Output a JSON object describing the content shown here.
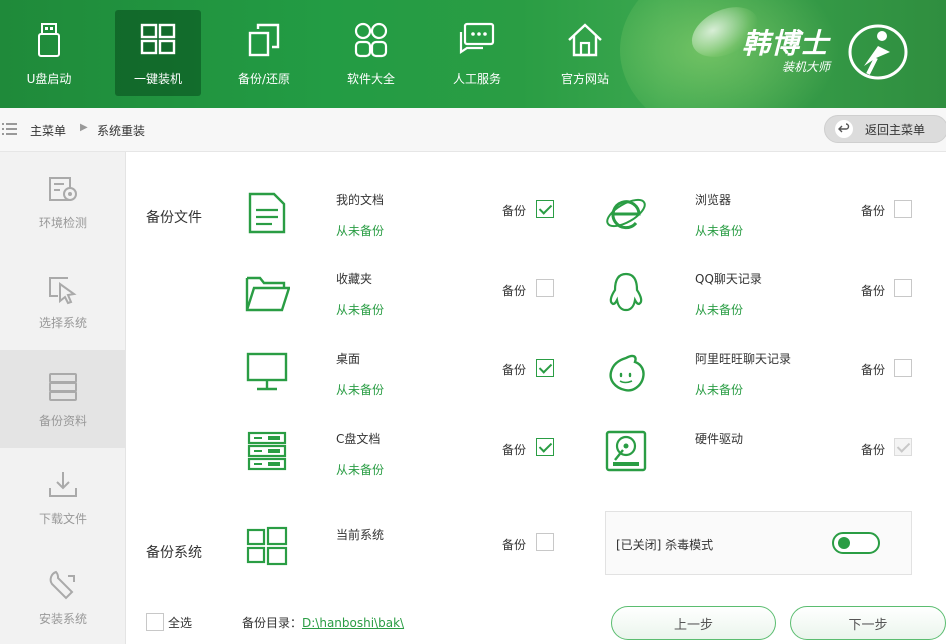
{
  "header": {
    "nav": [
      {
        "label": "U盘启动",
        "icon": "usb-drive-icon"
      },
      {
        "label": "一键装机",
        "icon": "windows-icon"
      },
      {
        "label": "备份/还原",
        "icon": "backup-restore-icon"
      },
      {
        "label": "软件大全",
        "icon": "apps-grid-icon"
      },
      {
        "label": "人工服务",
        "icon": "chat-icon"
      },
      {
        "label": "官方网站",
        "icon": "home-icon"
      }
    ],
    "active_index": 1,
    "brand_title": "韩博士",
    "brand_subtitle": "装机大师"
  },
  "breadcrumb": {
    "root": "主菜单",
    "current": "系统重装",
    "back_label": "返回主菜单"
  },
  "sidebar": {
    "items": [
      {
        "label": "环境检测",
        "icon": "environment-check-icon"
      },
      {
        "label": "选择系统",
        "icon": "cursor-select-icon"
      },
      {
        "label": "备份资料",
        "icon": "backup-data-icon"
      },
      {
        "label": "下载文件",
        "icon": "download-icon"
      },
      {
        "label": "安装系统",
        "icon": "wrench-install-icon"
      }
    ],
    "active_index": 2
  },
  "backup_files": {
    "title": "备份文件",
    "backup_label": "备份",
    "left": [
      {
        "name": "我的文档",
        "status": "从未备份",
        "checked": true,
        "icon": "document-icon"
      },
      {
        "name": "收藏夹",
        "status": "从未备份",
        "checked": false,
        "icon": "folder-icon"
      },
      {
        "name": "桌面",
        "status": "从未备份",
        "checked": true,
        "icon": "monitor-icon"
      },
      {
        "name": "C盘文档",
        "status": "从未备份",
        "checked": true,
        "icon": "server-rack-icon"
      }
    ],
    "right": [
      {
        "name": "浏览器",
        "status": "从未备份",
        "checked": false,
        "icon": "ie-browser-icon"
      },
      {
        "name": "QQ聊天记录",
        "status": "从未备份",
        "checked": false,
        "icon": "qq-penguin-icon"
      },
      {
        "name": "阿里旺旺聊天记录",
        "status": "从未备份",
        "checked": false,
        "icon": "aliwangwang-icon"
      },
      {
        "name": "硬件驱动",
        "status": "",
        "checked": true,
        "disabled": true,
        "icon": "hard-drive-icon"
      }
    ]
  },
  "backup_system": {
    "title": "备份系统",
    "name": "当前系统",
    "checked": false
  },
  "antivirus": {
    "label": "[已关闭] 杀毒模式",
    "enabled": true
  },
  "footer": {
    "select_all": "全选",
    "dir_label": "备份目录：",
    "dir_path": "D:\\hanboshi\\bak\\",
    "prev": "上一步",
    "next": "下一步"
  },
  "colors": {
    "accent": "#2a9d44",
    "header": "#239c44"
  }
}
